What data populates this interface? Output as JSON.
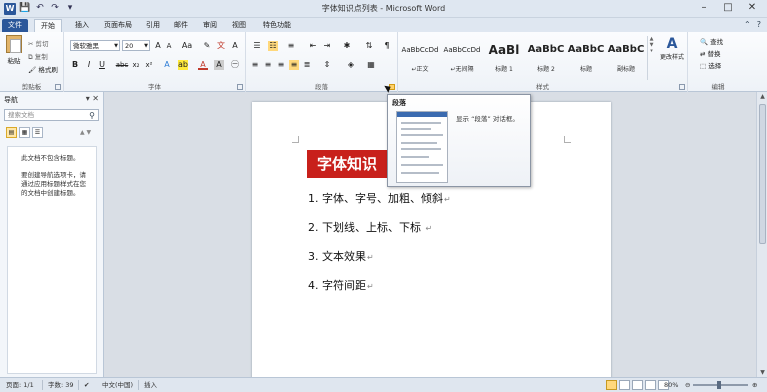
{
  "window": {
    "title": "字体知识点列表 - Microsoft Word",
    "app_letter": "W"
  },
  "qat": [
    "💾",
    "↶",
    "↷",
    "▾"
  ],
  "win_buttons": [
    "–",
    "□",
    "✕"
  ],
  "tabs": [
    {
      "label": "文件"
    },
    {
      "label": "开始"
    },
    {
      "label": "插入"
    },
    {
      "label": "页面布局"
    },
    {
      "label": "引用"
    },
    {
      "label": "邮件"
    },
    {
      "label": "审阅"
    },
    {
      "label": "视图"
    },
    {
      "label": "特色功能"
    }
  ],
  "ribbon": {
    "clipboard": {
      "paste": "粘贴",
      "cut": "剪切",
      "copy": "复制",
      "format_painter": "格式刷",
      "label": "剪贴板"
    },
    "font": {
      "name": "微软雅黑",
      "size": "20",
      "label": "字体"
    },
    "paragraph": {
      "label": "段落"
    },
    "styles": {
      "label": "样式",
      "items": [
        {
          "sample": "AaBbCcDd",
          "name": "↵正文"
        },
        {
          "sample": "AaBbCcDd",
          "name": "↵无间隔"
        },
        {
          "sample": "AaBl",
          "name": "标题 1"
        },
        {
          "sample": "AaBbC",
          "name": "标题 2"
        },
        {
          "sample": "AaBbC",
          "name": "标题"
        },
        {
          "sample": "AaBbC",
          "name": "副标题"
        }
      ],
      "change_styles": "更改样式"
    },
    "editing": {
      "label": "编辑",
      "find": "查找",
      "replace": "替换",
      "select": "选择"
    }
  },
  "nav": {
    "title": "导航",
    "search_placeholder": "搜索文档",
    "msg1": "此文档不包含标题。",
    "msg2": "要创建导航选项卡，请通过应用标题样式在您的文档中创建标题。"
  },
  "tooltip": {
    "title": "段落",
    "desc": "显示 “段落” 对话框。"
  },
  "document": {
    "title": "字体知识",
    "lines": [
      "1. 字体、字号、加粗、倾斜",
      "2. 下划线、上标、下标 ",
      "3. 文本效果",
      "4. 字符间距"
    ],
    "para_mark": "↵"
  },
  "status": {
    "page": "页面: 1/1",
    "words": "字数: 39",
    "lang": "中文(中国)",
    "mode": "插入",
    "zoom": "80%"
  }
}
